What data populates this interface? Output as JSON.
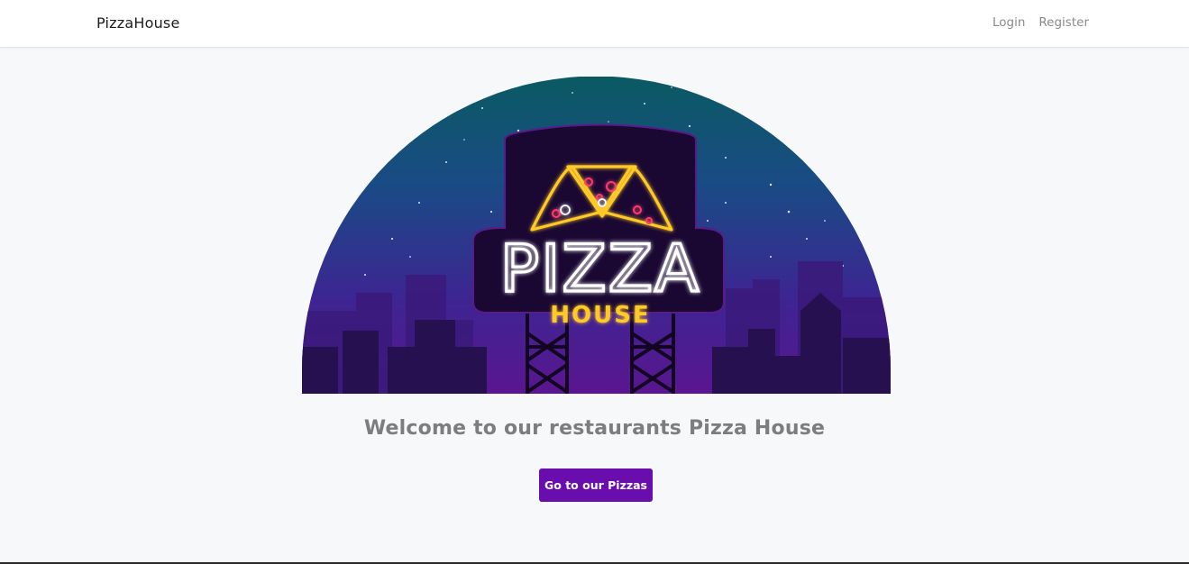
{
  "nav": {
    "brand": "PizzaHouse",
    "links": [
      {
        "label": "Login"
      },
      {
        "label": "Register"
      }
    ]
  },
  "hero": {
    "sign_line1": "PIZZA",
    "sign_line2": "HOUSE"
  },
  "main": {
    "welcome": "Welcome to our restaurants Pizza House",
    "cta_label": "Go to our Pizzas"
  },
  "colors": {
    "accent": "#6a0dad",
    "sky_top": "#0b5560",
    "sky_bottom": "#4a1185",
    "neon_white": "#ffffff",
    "neon_yellow": "#ffc928"
  }
}
